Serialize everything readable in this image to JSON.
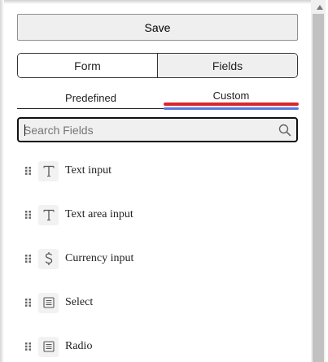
{
  "toolbar": {
    "save_label": "Save"
  },
  "mode_tabs": [
    {
      "label": "Form",
      "selected": false
    },
    {
      "label": "Fields",
      "selected": true
    }
  ],
  "sub_tabs": [
    {
      "label": "Predefined",
      "selected": false
    },
    {
      "label": "Custom",
      "selected": true
    }
  ],
  "search": {
    "placeholder": "Search Fields",
    "value": ""
  },
  "fields": [
    {
      "label": "Text input",
      "icon": "text-T-icon"
    },
    {
      "label": "Text area input",
      "icon": "text-T-icon"
    },
    {
      "label": "Currency input",
      "icon": "dollar-icon"
    },
    {
      "label": "Select",
      "icon": "list-icon"
    },
    {
      "label": "Radio",
      "icon": "list-icon"
    }
  ],
  "colors": {
    "active_indicator_red": "#d9262c",
    "active_indicator_blue": "#5a79d9",
    "scrollbar_thumb": "#c1c1c1"
  }
}
